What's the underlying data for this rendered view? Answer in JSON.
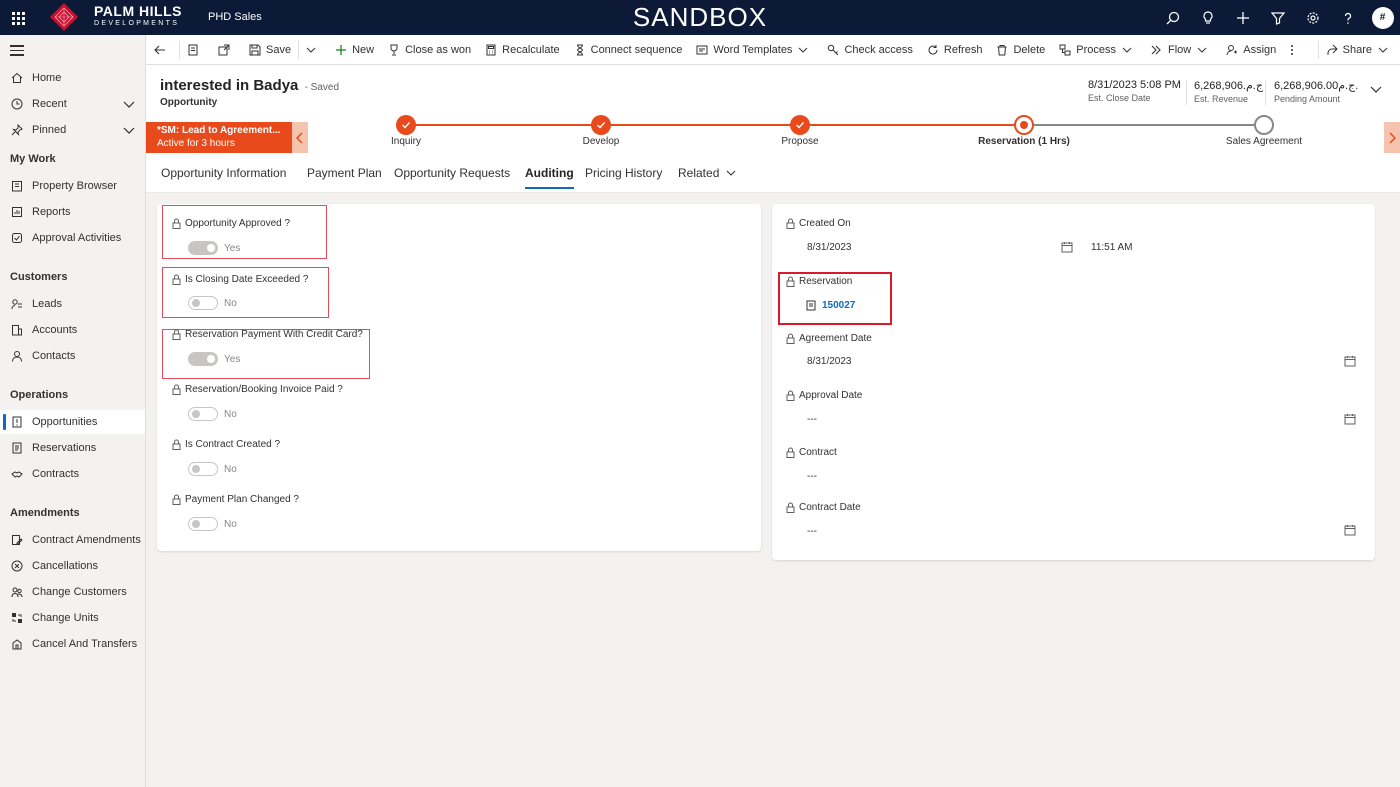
{
  "topbar": {
    "brand_main": "PALM HILLS",
    "brand_sub": "DEVELOPMENTS",
    "app_name": "PHD Sales",
    "environment": "SANDBOX",
    "avatar_initial": "#",
    "icons": [
      "search-icon",
      "lightbulb-icon",
      "plus-icon",
      "filter-icon",
      "gear-icon",
      "help-icon"
    ]
  },
  "sidebar": {
    "top_items": [
      {
        "label": "Home",
        "icon": "home-icon"
      },
      {
        "label": "Recent",
        "icon": "clock-icon"
      },
      {
        "label": "Pinned",
        "icon": "pin-icon"
      }
    ],
    "groups": [
      {
        "title": "My Work",
        "items": [
          {
            "label": "Property Browser",
            "icon": "building-icon"
          },
          {
            "label": "Reports",
            "icon": "report-icon"
          },
          {
            "label": "Approval Activities",
            "icon": "approval-icon"
          }
        ]
      },
      {
        "title": "Customers",
        "items": [
          {
            "label": "Leads",
            "icon": "phone-person-icon"
          },
          {
            "label": "Accounts",
            "icon": "building-icon"
          },
          {
            "label": "Contacts",
            "icon": "person-icon"
          }
        ]
      },
      {
        "title": "Operations",
        "items": [
          {
            "label": "Opportunities",
            "icon": "opportunity-icon"
          },
          {
            "label": "Reservations",
            "icon": "document-icon"
          },
          {
            "label": "Contracts",
            "icon": "handshake-icon"
          }
        ]
      },
      {
        "title": "Amendments",
        "items": [
          {
            "label": "Contract Amendments",
            "icon": "edit-document-icon"
          },
          {
            "label": "Cancellations",
            "icon": "cancel-circle-icon"
          },
          {
            "label": "Change Customers",
            "icon": "people-swap-icon"
          },
          {
            "label": "Change Units",
            "icon": "swap-icon"
          },
          {
            "label": "Cancel And Transfers",
            "icon": "transfer-icon"
          }
        ]
      }
    ]
  },
  "commands": {
    "save": "Save",
    "new": "New",
    "close_as_won": "Close as won",
    "recalculate": "Recalculate",
    "connect_sequence": "Connect sequence",
    "word_templates": "Word Templates",
    "check_access": "Check access",
    "refresh": "Refresh",
    "delete": "Delete",
    "process": "Process",
    "flow": "Flow",
    "assign": "Assign",
    "share": "Share"
  },
  "header": {
    "title": "interested in Badya",
    "saved_status": "- Saved",
    "entity": "Opportunity",
    "kpis": [
      {
        "value": "8/31/2023 5:08 PM",
        "label": "Est. Close Date"
      },
      {
        "value": "6,268,906.ج.م",
        "label": "Est. Revenue"
      },
      {
        "value": "6,268,906.00ج.م.",
        "label": "Pending Amount"
      }
    ]
  },
  "bpf": {
    "active_stage_title": "*SM: Lead to Agreement...",
    "active_duration": "Active for 3 hours",
    "stages": [
      {
        "label": "Inquiry",
        "state": "done"
      },
      {
        "label": "Develop",
        "state": "done"
      },
      {
        "label": "Propose",
        "state": "done"
      },
      {
        "label": "Reservation  (1 Hrs)",
        "state": "active"
      },
      {
        "label": "Sales Agreement",
        "state": "pending"
      }
    ],
    "accent_color": "#e84a1b"
  },
  "tabs": [
    {
      "label": "Opportunity Information"
    },
    {
      "label": "Payment Plan"
    },
    {
      "label": "Opportunity Requests"
    },
    {
      "label": "Auditing",
      "active": true
    },
    {
      "label": "Pricing History"
    },
    {
      "label": "Related"
    }
  ],
  "left_fields": [
    {
      "label": "Opportunity Approved ?",
      "value": "Yes",
      "on": true
    },
    {
      "label": "Is Closing Date Exceeded ?",
      "value": "No",
      "on": false
    },
    {
      "label": "Reservation Payment With Credit Card?",
      "value": "Yes",
      "on": true
    },
    {
      "label": "Reservation/Booking Invoice Paid ?",
      "value": "No",
      "on": false
    },
    {
      "label": "Is Contract Created ?",
      "value": "No",
      "on": false
    },
    {
      "label": "Payment Plan Changed ?",
      "value": "No",
      "on": false
    }
  ],
  "right_fields": {
    "created_on": {
      "label": "Created On",
      "date": "8/31/2023",
      "time": "11:51 AM"
    },
    "reservation": {
      "label": "Reservation",
      "value": "150027"
    },
    "agreement_date": {
      "label": "Agreement Date",
      "value": "8/31/2023"
    },
    "approval_date": {
      "label": "Approval Date",
      "value": "---"
    },
    "contract": {
      "label": "Contract",
      "value": "---"
    },
    "contract_date": {
      "label": "Contract Date",
      "value": "---"
    }
  }
}
